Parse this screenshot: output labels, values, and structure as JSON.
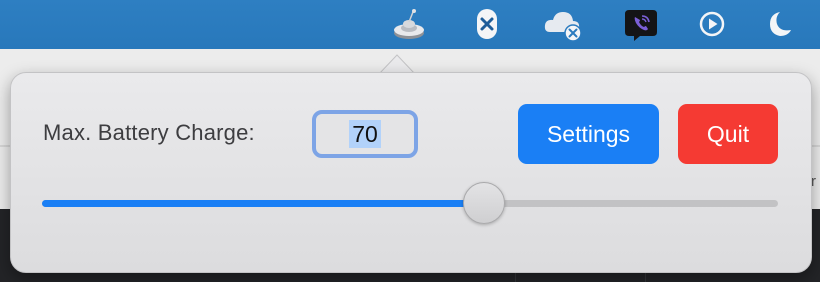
{
  "menubar": {
    "icons": [
      "battery-limiter-icon",
      "close-badge-icon",
      "cloud-disconnected-icon",
      "viber-icon",
      "play-circle-icon",
      "moon-icon"
    ]
  },
  "background_window": {
    "edge_char": "r"
  },
  "popover": {
    "label": "Max. Battery Charge:",
    "charge_value": "70",
    "settings_label": "Settings",
    "quit_label": "Quit",
    "slider": {
      "value_fraction": 0.6
    }
  },
  "colors": {
    "accent": "#1a7ff5",
    "quit": "#f53a33",
    "menubar": "#2b7bbf"
  }
}
